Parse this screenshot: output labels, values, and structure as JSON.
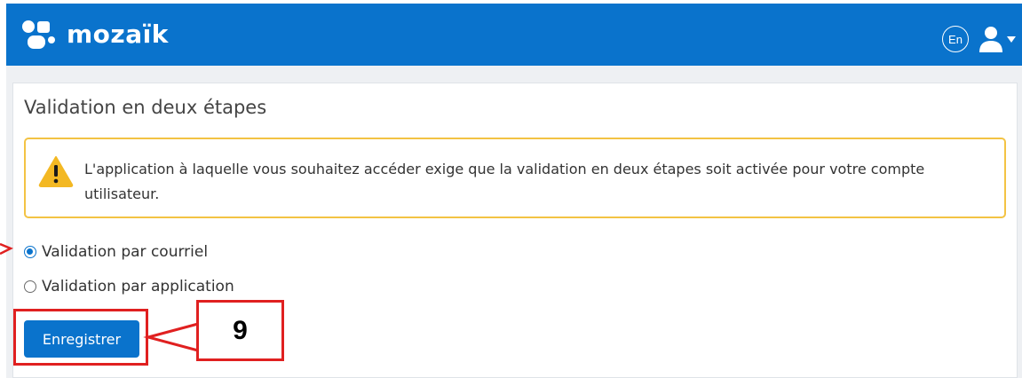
{
  "header": {
    "app_name": "mozaïk",
    "language_button": "En",
    "accent_color": "#0a73cc"
  },
  "page": {
    "title": "Validation en deux étapes",
    "alert": {
      "icon": "warning-icon",
      "text": "L'application à laquelle vous souhaitez accéder exige que la validation en deux étapes soit activée pour votre compte utilisateur."
    },
    "options": [
      {
        "label": "Validation par courriel",
        "selected": true
      },
      {
        "label": "Validation par application",
        "selected": false
      }
    ],
    "save_label": "Enregistrer"
  },
  "annotation": {
    "step_number": "9",
    "color": "#e02020"
  }
}
